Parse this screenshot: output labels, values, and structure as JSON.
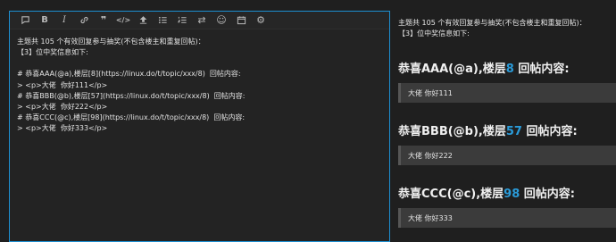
{
  "toolbar": {
    "buttons": [
      {
        "name": "chat-bubble-icon"
      },
      {
        "name": "bold-icon",
        "glyph": "B"
      },
      {
        "name": "italic-icon",
        "glyph": "I"
      },
      {
        "name": "link-icon"
      },
      {
        "name": "quote-icon",
        "glyph": "❞"
      },
      {
        "name": "code-icon",
        "glyph": "</>"
      },
      {
        "name": "upload-icon"
      },
      {
        "name": "bullet-list-icon"
      },
      {
        "name": "numbered-list-icon"
      },
      {
        "name": "swap-icon",
        "glyph": "⇄"
      },
      {
        "name": "emoji-icon",
        "glyph": "☺"
      },
      {
        "name": "calendar-icon"
      },
      {
        "name": "gear-icon",
        "glyph": "⚙"
      }
    ]
  },
  "editor": {
    "lines": [
      "主题共 105 个有效回复参与抽奖(不包含楼主和重复回帖)：",
      "【3】位中奖信息如下:",
      "",
      "# 恭喜AAA(@a),楼层[8](https://linux.do/t/topic/xxx/8)  回帖内容:",
      "> <p>大佬  你好111</p>",
      "# 恭喜BBB(@b),楼层[57](https://linux.do/t/topic/xxx/8)  回帖内容:",
      "> <p>大佬  你好222</p>",
      "# 恭喜CCC(@c),楼层[98](https://linux.do/t/topic/xxx/8)  回帖内容:",
      "> <p>大佬  你好333</p>"
    ]
  },
  "preview": {
    "intro_line1": "主题共 105 个有效回复参与抽奖(不包含楼主和重复回帖)：",
    "intro_line2": "【3】位中奖信息如下:",
    "winners": [
      {
        "prefix": "恭喜AAA(@a),楼层",
        "floor": "8",
        "suffix": " 回帖内容:",
        "reply": "大佬 你好111"
      },
      {
        "prefix": "恭喜BBB(@b),楼层",
        "floor": "57",
        "suffix": " 回帖内容:",
        "reply": "大佬 你好222"
      },
      {
        "prefix": "恭喜CCC(@c),楼层",
        "floor": "98",
        "suffix": " 回帖内容:",
        "reply": "大佬 你好333"
      }
    ]
  }
}
